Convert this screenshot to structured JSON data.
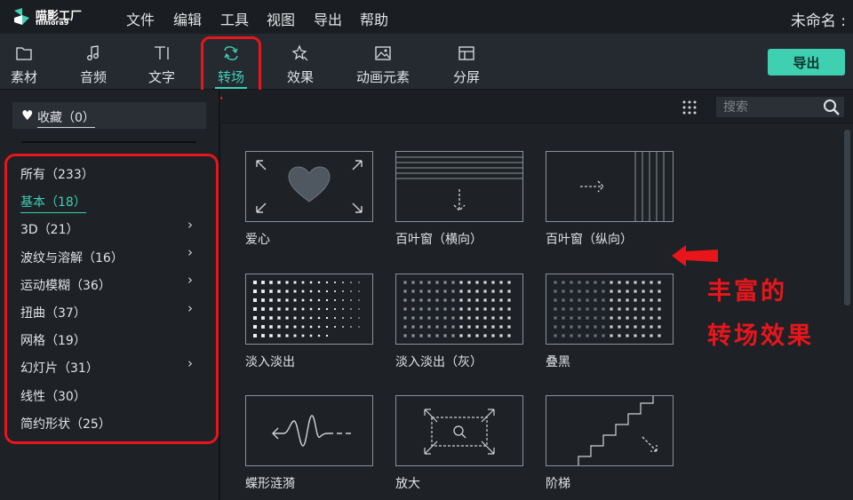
{
  "app": {
    "brand": "喵影工厂",
    "brand_sub": "filmora9",
    "project_title": "未命名 :"
  },
  "menu": [
    "文件",
    "编辑",
    "工具",
    "视图",
    "导出",
    "帮助"
  ],
  "toolbar": {
    "tabs": [
      {
        "label": "素材",
        "icon": "folder-icon"
      },
      {
        "label": "音频",
        "icon": "music-note-icon"
      },
      {
        "label": "文字",
        "icon": "text-icon"
      },
      {
        "label": "转场",
        "icon": "transition-icon",
        "active": true
      },
      {
        "label": "效果",
        "icon": "effects-icon"
      },
      {
        "label": "动画元素",
        "icon": "image-icon"
      },
      {
        "label": "分屏",
        "icon": "split-screen-icon"
      }
    ],
    "export_label": "导出"
  },
  "sidebar": {
    "favorites": "收藏（0）",
    "categories": [
      {
        "label": "所有（233）"
      },
      {
        "label": "基本（18）",
        "selected": true
      },
      {
        "label": "3D（21）",
        "has_children": true
      },
      {
        "label": "波纹与溶解（16）",
        "has_children": true
      },
      {
        "label": "运动模糊（36）",
        "has_children": true
      },
      {
        "label": "扭曲（37）",
        "has_children": true
      },
      {
        "label": "网格（19）"
      },
      {
        "label": "幻灯片（31）",
        "has_children": true
      },
      {
        "label": "线性（30）"
      },
      {
        "label": "简约形状（25）"
      }
    ]
  },
  "search": {
    "placeholder": "搜索"
  },
  "transitions": [
    {
      "label": "爱心",
      "icon": "heart-transition-icon"
    },
    {
      "label": "百叶窗（横向）",
      "icon": "blinds-horizontal-icon"
    },
    {
      "label": "百叶窗（纵向）",
      "icon": "blinds-vertical-icon"
    },
    {
      "label": "淡入淡出",
      "icon": "fade-dots-icon"
    },
    {
      "label": "淡入淡出（灰）",
      "icon": "fade-gray-dots-icon"
    },
    {
      "label": "叠黑",
      "icon": "dip-to-black-icon"
    },
    {
      "label": "蝶形涟漪",
      "icon": "ripple-wave-icon"
    },
    {
      "label": "放大",
      "icon": "zoom-in-icon"
    },
    {
      "label": "阶梯",
      "icon": "stairs-icon"
    }
  ],
  "annotation": {
    "line1": "丰富的",
    "line2": "转场效果"
  },
  "colors": {
    "accent": "#3fd0b4",
    "annotation_red": "#e8161b",
    "background": "#1e2227"
  }
}
